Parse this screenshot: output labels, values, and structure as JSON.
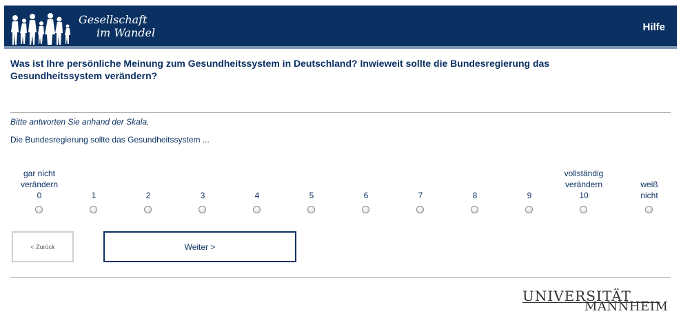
{
  "header": {
    "logo_line1": "Gesellschaft",
    "logo_line2": "im Wandel",
    "help_label": "Hilfe"
  },
  "question": {
    "text": "Was ist Ihre persönliche Meinung zum Gesundheitssystem in Deutschland? Inwieweit sollte die Bundesregierung das Gesundheitssystem verändern?",
    "instruction": "Bitte antworten Sie anhand der Skala.",
    "stem": "Die Bundesregierung sollte das Gesundheitssystem ..."
  },
  "scale": {
    "options": [
      {
        "label": "gar nicht\nverändern\n0",
        "selected": false
      },
      {
        "label": "1",
        "selected": false
      },
      {
        "label": "2",
        "selected": false
      },
      {
        "label": "3",
        "selected": false
      },
      {
        "label": "4",
        "selected": false
      },
      {
        "label": "5",
        "selected": false
      },
      {
        "label": "6",
        "selected": false
      },
      {
        "label": "7",
        "selected": false
      },
      {
        "label": "8",
        "selected": false
      },
      {
        "label": "9",
        "selected": false
      },
      {
        "label": "vollständig\nverändern\n10",
        "selected": false
      },
      {
        "label": "weiß\nnicht",
        "selected": false
      }
    ]
  },
  "nav": {
    "back_label": "< Zurück",
    "next_label": "Weiter >"
  },
  "footer": {
    "logo_line1": "UNIVERSITÄT",
    "logo_line2": "MANNHEIM"
  },
  "colors": {
    "primary": "#0b3162",
    "header_accent": "#7e97b5",
    "rule": "#b2b2b2"
  }
}
